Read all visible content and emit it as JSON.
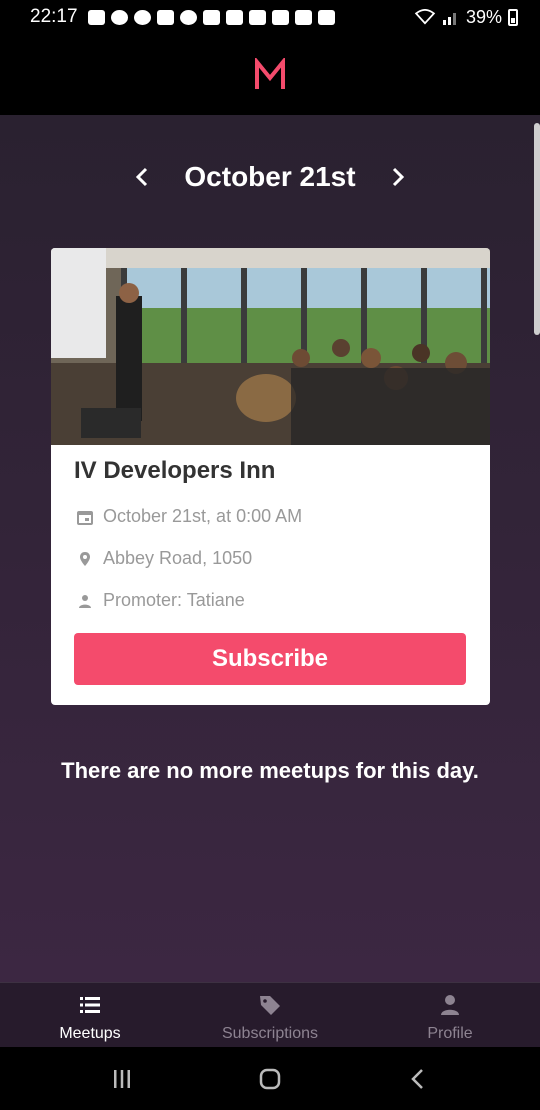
{
  "status_bar": {
    "time": "22:17",
    "battery": "39%",
    "notification_icons": [
      "message-icon",
      "facebook-icon",
      "facebook-icon",
      "youtube-icon",
      "reddit-icon",
      "gmail-icon",
      "ifood-icon",
      "multiwindow-icon",
      "ifood-icon",
      "warning-icon",
      "image-icon"
    ]
  },
  "header": {
    "logo": "M"
  },
  "date_nav": {
    "title": "October 21st"
  },
  "event": {
    "title": "IV Developers Inn",
    "datetime": "October 21st, at 0:00 AM",
    "place": "Abbey Road, 1050",
    "promoter": "Promoter: Tatiane",
    "button_label": "Subscribe"
  },
  "empty_message": "There are no more meetups for this day.",
  "tabs": [
    {
      "label": "Meetups",
      "icon": "list-icon"
    },
    {
      "label": "Subscriptions",
      "icon": "tag-icon"
    },
    {
      "label": "Profile",
      "icon": "person-icon"
    }
  ],
  "colors": {
    "accent": "#f44b6c",
    "background_top": "#2a2130",
    "background_bottom": "#3c2742",
    "tab_bar": "#271b2c"
  }
}
